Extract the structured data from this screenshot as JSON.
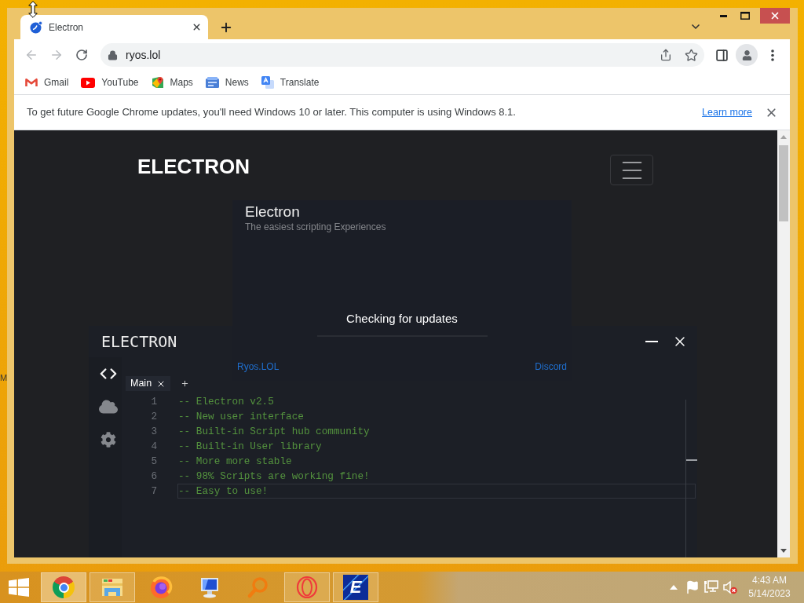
{
  "desktop": {
    "edge_text": "M"
  },
  "browser": {
    "tabs": [
      {
        "title": "Electron",
        "selected": true
      }
    ],
    "address": "ryos.lol",
    "bookmarks": [
      {
        "kind": "mail",
        "label": "Gmail"
      },
      {
        "kind": "video",
        "label": "YouTube"
      },
      {
        "kind": "map",
        "label": "Maps"
      },
      {
        "kind": "news",
        "label": "News"
      },
      {
        "kind": "translate",
        "label": "Translate"
      }
    ],
    "infobar": {
      "message": "To get future Google Chrome updates, you'll need Windows 10 or later. This computer is using Windows 8.1.",
      "link": "Learn more"
    }
  },
  "page": {
    "brand": "ELECTRON",
    "loader": {
      "title": "Electron",
      "subtitle": "The easiest scripting Experiences",
      "status": "Checking for updates",
      "level": 0,
      "links": [
        "Ryos.LOL",
        "Discord"
      ]
    },
    "editor": {
      "title": "ELECTRON",
      "sidebar": [
        {
          "kind": "code",
          "selected": true
        },
        {
          "kind": "cloud",
          "selected": false
        },
        {
          "kind": "settings",
          "selected": false
        }
      ],
      "tabs": [
        {
          "label": "Main",
          "selected": true
        }
      ],
      "lines": [
        {
          "number": "1",
          "text": "-- Electron v2.5",
          "current": false
        },
        {
          "number": "2",
          "text": "-- New user interface",
          "current": false
        },
        {
          "number": "3",
          "text": "-- Built-in Script hub community",
          "current": false
        },
        {
          "number": "4",
          "text": "-- Built-in User library",
          "current": false
        },
        {
          "number": "5",
          "text": "-- More more stable",
          "current": false
        },
        {
          "number": "6",
          "text": "-- 98% Scripts are working fine!",
          "current": false
        },
        {
          "number": "7",
          "text": "-- Easy to use!",
          "current": true
        }
      ]
    }
  },
  "taskbar": {
    "apps": [
      {
        "kind": "chrome",
        "running": true,
        "selected": true
      },
      {
        "kind": "files",
        "running": true,
        "selected": false
      },
      {
        "kind": "firefox",
        "running": false,
        "selected": false
      },
      {
        "kind": "computer",
        "running": false,
        "selected": false
      },
      {
        "kind": "search",
        "running": false,
        "selected": false
      },
      {
        "kind": "opera",
        "running": true,
        "selected": false
      },
      {
        "kind": "letter_tile",
        "label": "E",
        "running": true,
        "selected": false
      }
    ],
    "clock": {
      "time": "4:43 AM",
      "date": "5/14/2023"
    }
  }
}
